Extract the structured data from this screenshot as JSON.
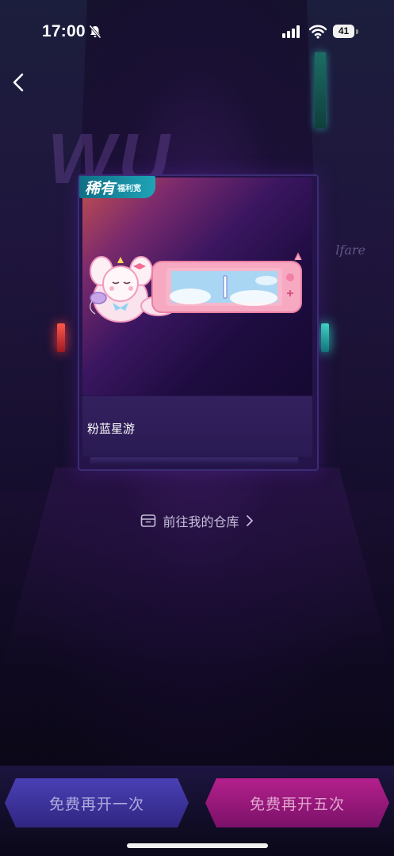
{
  "status_bar": {
    "time": "17:00",
    "battery": "41",
    "icons": [
      "bell-off-icon",
      "signal-icon",
      "wifi-icon",
      "battery-icon"
    ]
  },
  "nav": {
    "back_icon": "chevron-left-icon"
  },
  "card": {
    "rarity_main": "稀有",
    "rarity_sub": "福利宽",
    "item_name": "粉蓝星游"
  },
  "warehouse_link": {
    "label": "前往我的仓库",
    "icon": "box-icon"
  },
  "actions": {
    "open_once": "免费再开一次",
    "open_five": "免费再开五次"
  },
  "colors": {
    "open_once_bg": "#3b32a0",
    "open_five_bg": "#a01a7e",
    "rarity_badge": "#1592a8"
  }
}
